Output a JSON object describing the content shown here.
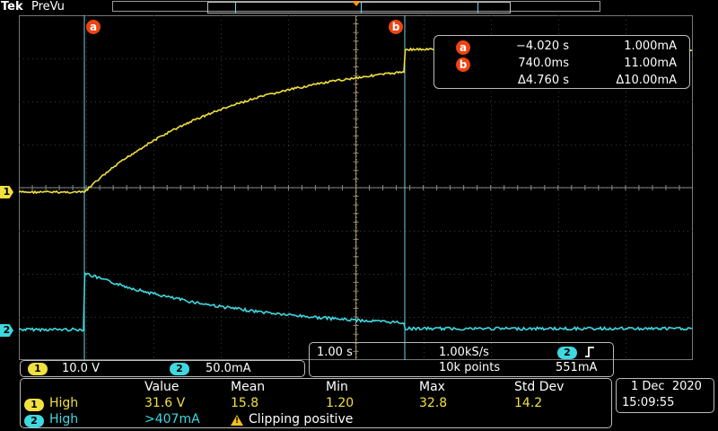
{
  "topbar": {
    "brand": "Tek",
    "mode": "PreVu"
  },
  "cursors": {
    "a_label": "a",
    "b_label": "b"
  },
  "channels": {
    "ch1_label": "1",
    "ch2_label": "2"
  },
  "cursor_readout": {
    "a": {
      "time": "−4.020 s",
      "amp": "1.000mA"
    },
    "b": {
      "time": "740.0ms",
      "amp": "11.00mA"
    },
    "delta": {
      "time": "Δ4.760 s",
      "amp": "Δ10.00mA"
    }
  },
  "ch_scale": {
    "ch1": "10.0 V",
    "ch2": "50.0mA"
  },
  "timebase": {
    "scale": "1.00 s",
    "sample_rate": "1.00kS/s",
    "points": "10k points",
    "trig_channel": "2",
    "trig_level": "551mA"
  },
  "measurements": {
    "headers": [
      "Value",
      "Mean",
      "Min",
      "Max",
      "Std Dev"
    ],
    "row1": {
      "label": "High",
      "value": "31.6 V",
      "mean": "15.8",
      "min": "1.20",
      "max": "32.8",
      "std": "14.2"
    },
    "row2": {
      "label": "High",
      "value": ">407mA",
      "warning": "Clipping positive"
    }
  },
  "datetime": {
    "date": "1 Dec  2020",
    "time": "15:09:55"
  },
  "colors": {
    "ch1": "#f0e040",
    "ch2": "#3fd8e0",
    "cursor": "#ee4411"
  }
}
